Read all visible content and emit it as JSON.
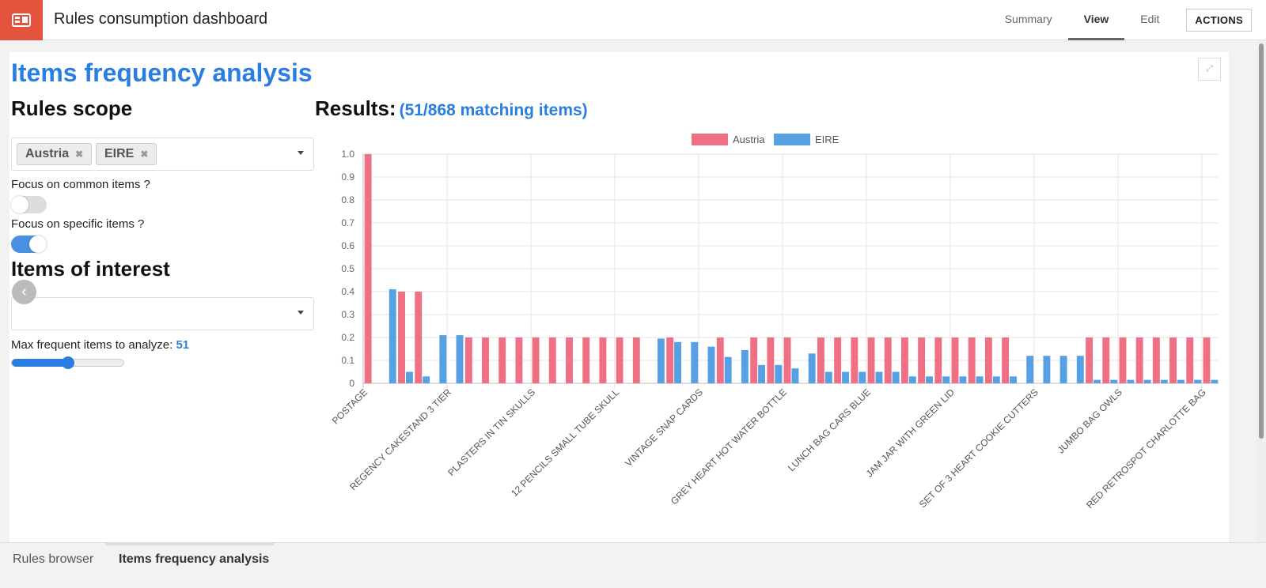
{
  "app": {
    "title": "Rules consumption dashboard",
    "logo_icon": "dashboard-icon",
    "accent_color": "#e4533d"
  },
  "nav": {
    "tabs": [
      {
        "label": "Summary",
        "active": false
      },
      {
        "label": "View",
        "active": true
      },
      {
        "label": "Edit",
        "active": false
      }
    ],
    "actions_label": "ACTIONS"
  },
  "panel": {
    "title": "Items frequency analysis",
    "expand_icon": "expand-icon"
  },
  "sidebar": {
    "rules_scope_title": "Rules scope",
    "scope_chips": [
      "Austria",
      "EIRE"
    ],
    "chip_remove_glyph": "✖",
    "focus_common_label": "Focus on common items ?",
    "focus_common_on": false,
    "focus_specific_label": "Focus on specific items ?",
    "focus_specific_on": true,
    "items_of_interest_title": "Items of interest",
    "items_of_interest_value": "",
    "max_items_label": "Max frequent items to analyze:",
    "max_items_value": "51",
    "max_items_slider_fraction": 0.5,
    "toggle_on_color": "#4a90e2"
  },
  "results": {
    "label": "Results:",
    "count_text": "(51/868 matching items)"
  },
  "chart_data": {
    "type": "bar",
    "title": "",
    "xlabel": "",
    "ylabel": "",
    "ylim": [
      0,
      1.0
    ],
    "yticks": [
      "0",
      "0.1",
      "0.2",
      "0.3",
      "0.4",
      "0.5",
      "0.6",
      "0.7",
      "0.8",
      "0.9",
      "1.0"
    ],
    "grid": true,
    "legend": "top-center",
    "category_count": 51,
    "visible_labels": [
      {
        "index": 0,
        "label": "POSTAGE"
      },
      {
        "index": 5,
        "label": "REGENCY CAKESTAND 3 TIER"
      },
      {
        "index": 10,
        "label": "PLASTERS IN TIN SKULLS"
      },
      {
        "index": 15,
        "label": "12 PENCILS SMALL TUBE SKULL"
      },
      {
        "index": 20,
        "label": "VINTAGE SNAP CARDS"
      },
      {
        "index": 25,
        "label": "GREY HEART HOT WATER BOTTLE"
      },
      {
        "index": 30,
        "label": "LUNCH BAG CARS BLUE"
      },
      {
        "index": 35,
        "label": "JAM JAR WITH GREEN LID"
      },
      {
        "index": 40,
        "label": "SET OF 3 HEART COOKIE CUTTERS"
      },
      {
        "index": 45,
        "label": "JUMBO BAG OWLS"
      },
      {
        "index": 50,
        "label": "RED RETROSPOT CHARLOTTE BAG"
      }
    ],
    "series": [
      {
        "name": "Austria",
        "color": "#ef6f85",
        "values": [
          1.0,
          0,
          0.4,
          0.4,
          0,
          0,
          0.2,
          0.2,
          0.2,
          0.2,
          0.2,
          0.2,
          0.2,
          0.2,
          0.2,
          0.2,
          0.2,
          0,
          0.2,
          0,
          0,
          0.2,
          0,
          0.2,
          0.2,
          0.2,
          0,
          0.2,
          0.2,
          0.2,
          0.2,
          0.2,
          0.2,
          0.2,
          0.2,
          0.2,
          0.2,
          0.2,
          0.2,
          0,
          0,
          0,
          0,
          0.2,
          0.2,
          0.2,
          0.2,
          0.2,
          0.2,
          0.2,
          0.2
        ]
      },
      {
        "name": "EIRE",
        "color": "#56a0e3",
        "values": [
          0,
          0.41,
          0.05,
          0.03,
          0.21,
          0.21,
          0,
          0,
          0,
          0,
          0,
          0,
          0,
          0,
          0,
          0,
          0,
          0.195,
          0.18,
          0.18,
          0.16,
          0.115,
          0.145,
          0.08,
          0.08,
          0.065,
          0.13,
          0.05,
          0.05,
          0.05,
          0.05,
          0.05,
          0.03,
          0.03,
          0.03,
          0.03,
          0.03,
          0.03,
          0.03,
          0.12,
          0.12,
          0.12,
          0.12,
          0.015,
          0.015,
          0.015,
          0.015,
          0.015,
          0.015,
          0.015,
          0.015
        ]
      }
    ]
  },
  "bottom_tabs": [
    {
      "label": "Rules browser",
      "active": false
    },
    {
      "label": "Items frequency analysis",
      "active": true
    }
  ]
}
